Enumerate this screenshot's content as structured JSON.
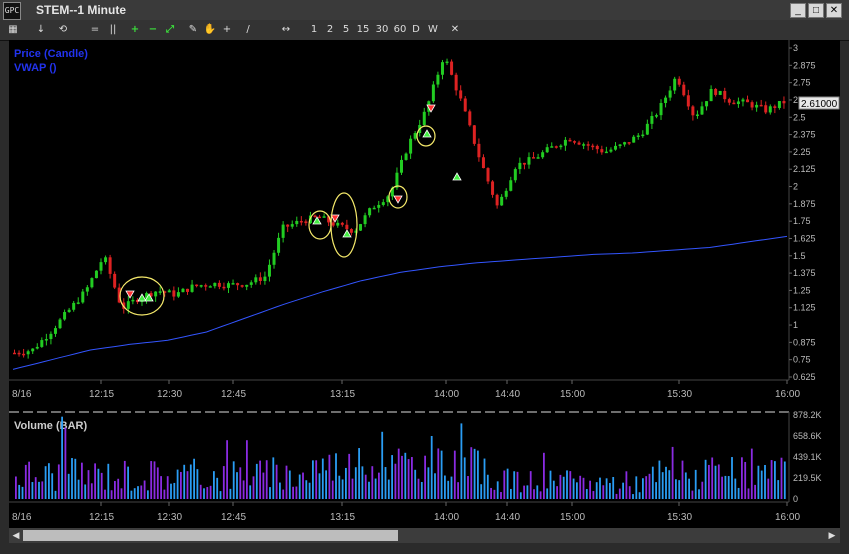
{
  "window": {
    "title": "STEM--1 Minute",
    "icon_text": "GPC"
  },
  "toolbar": {
    "items": [
      "↓",
      "⟲",
      "=",
      "||",
      "+",
      "−",
      "⤢",
      "✎",
      "✋",
      "+",
      "/",
      "↔"
    ],
    "periods": [
      "1",
      "2",
      "5",
      "15",
      "30",
      "60",
      "D",
      "W"
    ],
    "close_label": "✕"
  },
  "price_panel": {
    "legend": [
      "Price (Candle)",
      "VWAP ()"
    ],
    "yaxis_labels": [
      "3",
      "2.875",
      "2.75",
      "2.625",
      "2.5",
      "2.375",
      "2.25",
      "2.125",
      "2",
      "1.875",
      "1.75",
      "1.625",
      "1.5",
      "1.375",
      "1.25",
      "1.125",
      "1",
      "0.875",
      "0.75",
      "0.625"
    ],
    "last_price": "2.61000",
    "date_label": "8/16",
    "xaxis_labels": [
      "12:15",
      "12:30",
      "12:45",
      "13:15",
      "14:00",
      "14:40",
      "15:00",
      "15:30",
      "16:00"
    ]
  },
  "volume_panel": {
    "title": "Volume (BAR)",
    "yaxis_labels": [
      "878.2K",
      "658.6K",
      "439.1K",
      "219.5K",
      "0"
    ],
    "date_label": "8/16",
    "xaxis_labels": [
      "12:15",
      "12:30",
      "12:45",
      "13:15",
      "14:00",
      "14:40",
      "15:00",
      "15:30",
      "16:00"
    ]
  },
  "colors": {
    "up_candle": "#22cc22",
    "down_candle": "#dd2222",
    "vwap": "#3355ff",
    "legend": "#2233ee",
    "volume_blue": "#2a9df4",
    "volume_purple": "#8a2be2",
    "highlight": "#f5e96b"
  },
  "chart_data": [
    {
      "type": "candlestick",
      "title": "",
      "x_range": [
        "11:48",
        "16:00"
      ],
      "ylim": [
        0.625,
        3.0
      ],
      "series": [
        {
          "name": "Price (Candle)",
          "approx_close": [
            0.8,
            0.82,
            0.95,
            1.1,
            1.25,
            1.5,
            1.12,
            1.2,
            1.25,
            1.22,
            1.28,
            1.3,
            1.29,
            1.3,
            1.35,
            1.7,
            1.75,
            1.78,
            1.72,
            1.68,
            1.85,
            1.95,
            2.3,
            2.55,
            2.95,
            2.6,
            2.2,
            1.85,
            2.15,
            2.2,
            2.28,
            2.35,
            2.3,
            2.25,
            2.3,
            2.38,
            2.55,
            2.8,
            2.5,
            2.7,
            2.62,
            2.6,
            2.55,
            2.61
          ]
        },
        {
          "name": "VWAP ()",
          "approx_values": [
            0.68,
            0.75,
            0.82,
            0.86,
            0.89,
            0.95,
            1.05,
            1.15,
            1.24,
            1.32,
            1.38,
            1.42,
            1.45,
            1.47,
            1.49,
            1.51,
            1.52,
            1.54,
            1.56,
            1.6,
            1.64
          ]
        }
      ]
    },
    {
      "type": "bar",
      "title": "Volume (BAR)",
      "ylim": [
        0,
        878200
      ],
      "series": [
        {
          "name": "Volume (BAR)"
        }
      ]
    }
  ]
}
